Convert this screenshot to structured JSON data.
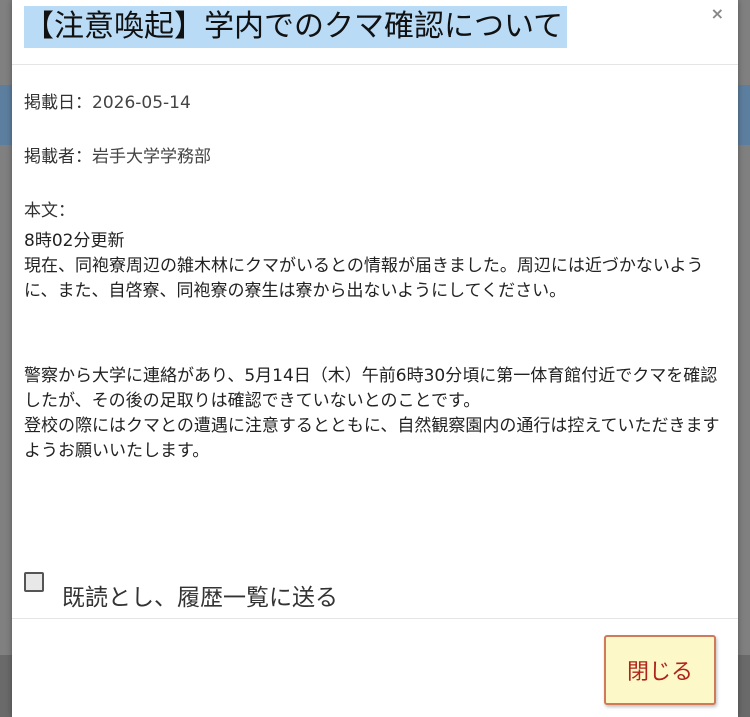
{
  "modal": {
    "title": "【注意喚起】学内でのクマ確認について",
    "close_icon": "×",
    "published_label": "掲載日：",
    "published_date": "2026-05-14",
    "author_label": "掲載者：",
    "author": "岩手大学学務部",
    "body_label": "本文：",
    "body_paragraphs": [
      "8時02分更新",
      "現在、同袍寮周辺の雑木林にクマがいるとの情報が届きました。周辺には近づかないように、また、自啓寮、同袍寮の寮生は寮から出ないようにしてください。",
      "警察から大学に連絡があり、5月14日（木）午前6時30分頃に第一体育館付近でクマを確認したが、その後の足取りは確認できていないとのことです。",
      "登校の際にはクマとの遭遇に注意するとともに、自然観察園内の通行は控えていただきますようお願いいたします。"
    ],
    "mark_read_label": "既読とし、履歴一覧に送る",
    "close_button_label": "閉じる"
  },
  "icons": {
    "close": "close-icon",
    "checkbox": "checkbox-unchecked"
  },
  "colors": {
    "title_highlight": "#b9dbf5",
    "close_button_bg": "#fdf8c8",
    "close_button_text": "#b0231a",
    "close_button_border": "#d07a5a"
  }
}
